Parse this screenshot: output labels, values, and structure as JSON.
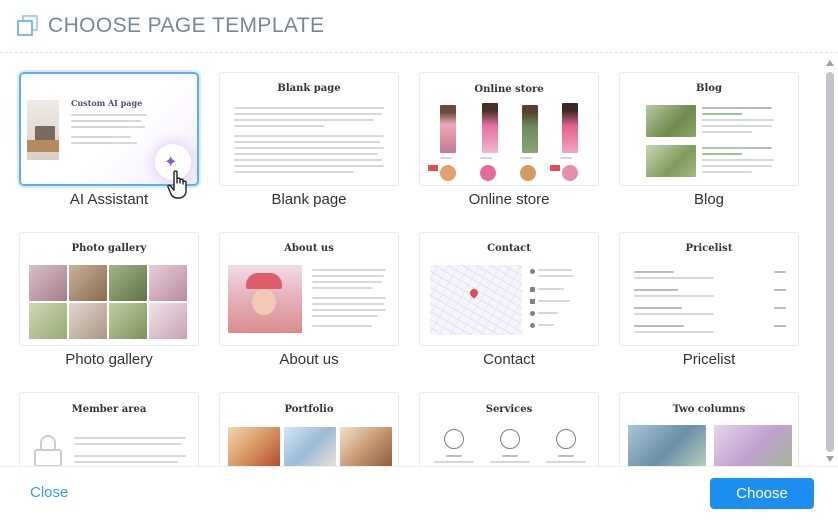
{
  "header": {
    "title": "CHOOSE PAGE TEMPLATE",
    "icon": "copy-pages-icon"
  },
  "templates": [
    {
      "label": "AI Assistant",
      "heading": "Custom AI page",
      "selected": true
    },
    {
      "label": "Blank page",
      "heading": "Blank page"
    },
    {
      "label": "Online store",
      "heading": "Online store"
    },
    {
      "label": "Blog",
      "heading": "Blog"
    },
    {
      "label": "Photo gallery",
      "heading": "Photo gallery"
    },
    {
      "label": "About us",
      "heading": "About us"
    },
    {
      "label": "Contact",
      "heading": "Contact"
    },
    {
      "label": "Pricelist",
      "heading": "Pricelist"
    },
    {
      "label": "",
      "heading": "Member area"
    },
    {
      "label": "",
      "heading": "Portfolio"
    },
    {
      "label": "",
      "heading": "Services"
    },
    {
      "label": "",
      "heading": "Two columns"
    }
  ],
  "footer": {
    "close_label": "Close",
    "choose_label": "Choose"
  },
  "colors": {
    "accent": "#1d8ff1",
    "selected_border": "#5ab0f2",
    "title": "#7b8694"
  }
}
